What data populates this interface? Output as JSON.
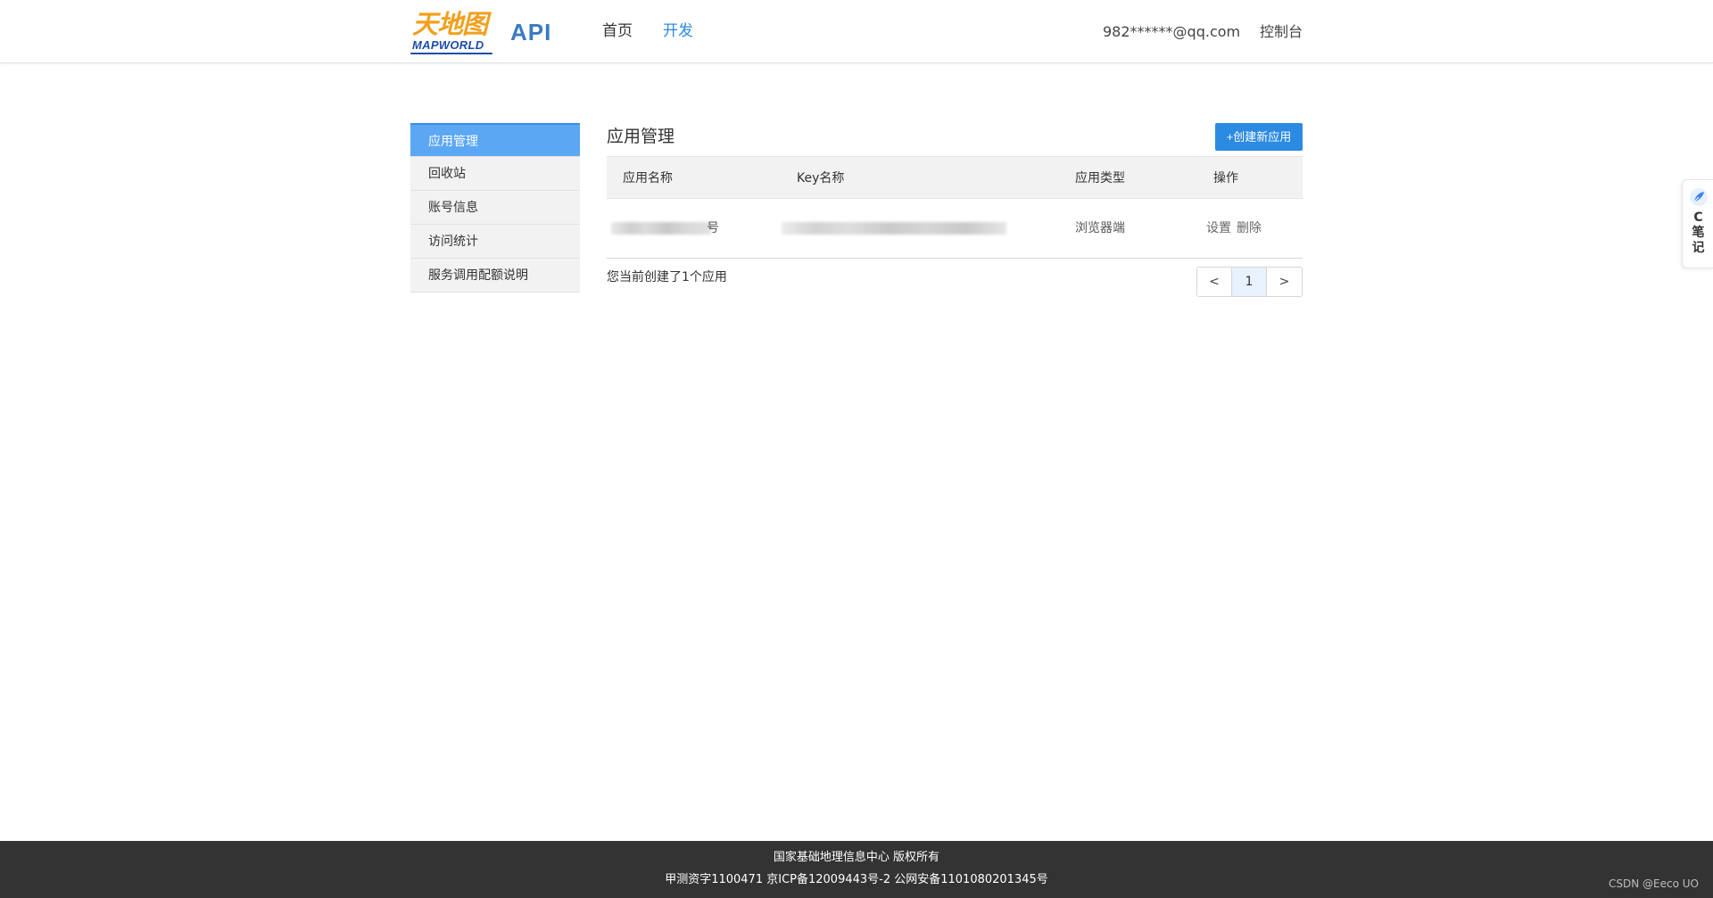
{
  "header": {
    "logo_cn": "天地图",
    "logo_en": "MAPWORLD",
    "brand": "API",
    "nav": [
      {
        "label": "首页",
        "active": false
      },
      {
        "label": "开发",
        "active": true
      }
    ],
    "user_email": "982******@qq.com",
    "console_label": "控制台"
  },
  "sidebar": {
    "items": [
      {
        "label": "应用管理",
        "active": true
      },
      {
        "label": "回收站",
        "active": false
      },
      {
        "label": "账号信息",
        "active": false
      },
      {
        "label": "访问统计",
        "active": false
      },
      {
        "label": "服务调用配额说明",
        "active": false
      }
    ]
  },
  "main": {
    "title": "应用管理",
    "create_button": "+创建新应用",
    "table": {
      "headers": [
        "应用名称",
        "Key名称",
        "应用类型",
        "操作"
      ],
      "rows": [
        {
          "app_name_tail": "号",
          "app_type": "浏览器端",
          "action_settings": "设置",
          "action_delete": "删除"
        }
      ]
    },
    "summary": "您当前创建了1个应用",
    "pager": {
      "prev": "<",
      "current": "1",
      "next": ">"
    }
  },
  "float_widget": {
    "text_c": "C",
    "text_1": "笔",
    "text_2": "记"
  },
  "footer": {
    "line1": "国家基础地理信息中心  版权所有",
    "line2": "甲测资字1100471  京ICP备12009443号-2  公网安备1101080201345号",
    "watermark": "CSDN @Eeco UO"
  },
  "colors": {
    "accent": "#2b8ae2",
    "sidebar_active": "#5ba7f4",
    "footer_bg": "#333333",
    "logo_orange": "#f0a01e",
    "logo_blue": "#1a4ea8"
  }
}
